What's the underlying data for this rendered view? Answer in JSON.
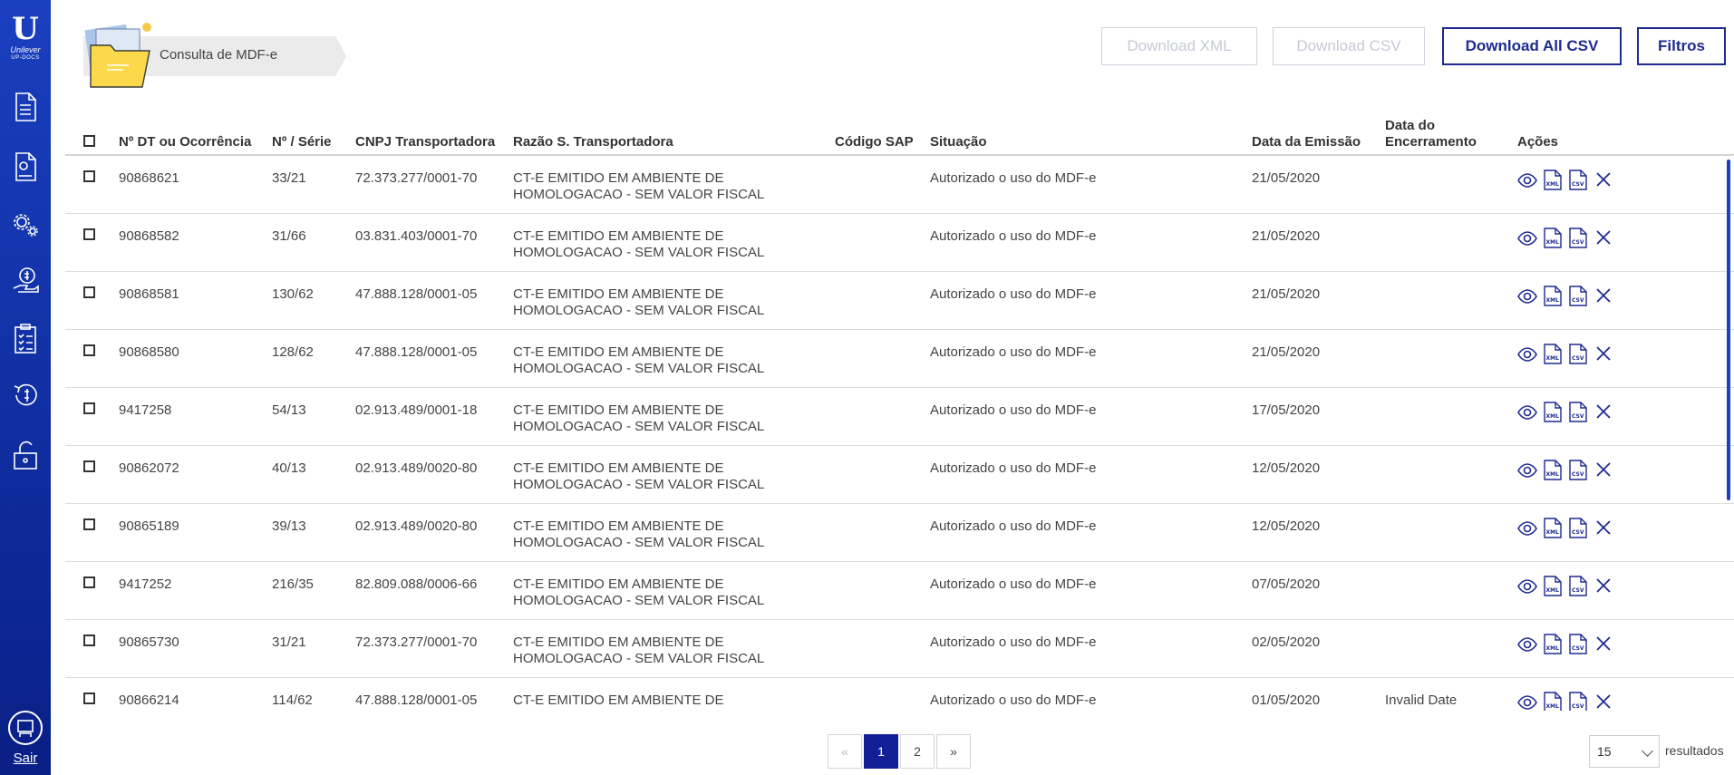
{
  "app": {
    "brand": "Unilever",
    "sub": "UP-DOCS",
    "logout_label": "Sair"
  },
  "breadcrumb": {
    "title": "Consulta de MDF-e"
  },
  "toolbar": {
    "download_xml": "Download XML",
    "download_csv": "Download CSV",
    "download_all_csv": "Download All CSV",
    "filters": "Filtros"
  },
  "table": {
    "headers": {
      "dt": "Nº DT ou Ocorrência",
      "serie": "Nº / Série",
      "cnpj": "CNPJ Transportadora",
      "razao": "Razão S. Transportadora",
      "sap": "Código SAP",
      "situacao": "Situação",
      "emissao": "Data da Emissão",
      "encerramento_1": "Data do",
      "encerramento_2": "Encerramento",
      "acoes": "Ações"
    },
    "rows": [
      {
        "dt": "90868621",
        "serie": "33/21",
        "cnpj": "72.373.277/0001-70",
        "razao1": "CT-E EMITIDO EM AMBIENTE DE",
        "razao2": "HOMOLOGACAO - SEM VALOR FISCAL",
        "sap": "",
        "situacao": "Autorizado o uso do MDF-e",
        "emissao": "21/05/2020",
        "encerramento": ""
      },
      {
        "dt": "90868582",
        "serie": "31/66",
        "cnpj": "03.831.403/0001-70",
        "razao1": "CT-E EMITIDO EM AMBIENTE DE",
        "razao2": "HOMOLOGACAO - SEM VALOR FISCAL",
        "sap": "",
        "situacao": "Autorizado o uso do MDF-e",
        "emissao": "21/05/2020",
        "encerramento": ""
      },
      {
        "dt": "90868581",
        "serie": "130/62",
        "cnpj": "47.888.128/0001-05",
        "razao1": "CT-E EMITIDO EM AMBIENTE DE",
        "razao2": "HOMOLOGACAO - SEM VALOR FISCAL",
        "sap": "",
        "situacao": "Autorizado o uso do MDF-e",
        "emissao": "21/05/2020",
        "encerramento": ""
      },
      {
        "dt": "90868580",
        "serie": "128/62",
        "cnpj": "47.888.128/0001-05",
        "razao1": "CT-E EMITIDO EM AMBIENTE DE",
        "razao2": "HOMOLOGACAO - SEM VALOR FISCAL",
        "sap": "",
        "situacao": "Autorizado o uso do MDF-e",
        "emissao": "21/05/2020",
        "encerramento": ""
      },
      {
        "dt": "9417258",
        "serie": "54/13",
        "cnpj": "02.913.489/0001-18",
        "razao1": "CT-E EMITIDO EM AMBIENTE DE",
        "razao2": "HOMOLOGACAO - SEM VALOR FISCAL",
        "sap": "",
        "situacao": "Autorizado o uso do MDF-e",
        "emissao": "17/05/2020",
        "encerramento": ""
      },
      {
        "dt": "90862072",
        "serie": "40/13",
        "cnpj": "02.913.489/0020-80",
        "razao1": "CT-E EMITIDO EM AMBIENTE DE",
        "razao2": "HOMOLOGACAO - SEM VALOR FISCAL",
        "sap": "",
        "situacao": "Autorizado o uso do MDF-e",
        "emissao": "12/05/2020",
        "encerramento": ""
      },
      {
        "dt": "90865189",
        "serie": "39/13",
        "cnpj": "02.913.489/0020-80",
        "razao1": "CT-E EMITIDO EM AMBIENTE DE",
        "razao2": "HOMOLOGACAO - SEM VALOR FISCAL",
        "sap": "",
        "situacao": "Autorizado o uso do MDF-e",
        "emissao": "12/05/2020",
        "encerramento": ""
      },
      {
        "dt": "9417252",
        "serie": "216/35",
        "cnpj": "82.809.088/0006-66",
        "razao1": "CT-E EMITIDO EM AMBIENTE DE",
        "razao2": "HOMOLOGACAO - SEM VALOR FISCAL",
        "sap": "",
        "situacao": "Autorizado o uso do MDF-e",
        "emissao": "07/05/2020",
        "encerramento": ""
      },
      {
        "dt": "90865730",
        "serie": "31/21",
        "cnpj": "72.373.277/0001-70",
        "razao1": "CT-E EMITIDO EM AMBIENTE DE",
        "razao2": "HOMOLOGACAO - SEM VALOR FISCAL",
        "sap": "",
        "situacao": "Autorizado o uso do MDF-e",
        "emissao": "02/05/2020",
        "encerramento": ""
      },
      {
        "dt": "90866214",
        "serie": "114/62",
        "cnpj": "47.888.128/0001-05",
        "razao1": "CT-E EMITIDO EM AMBIENTE DE",
        "razao2": "",
        "sap": "",
        "situacao": "Autorizado o uso do MDF-e",
        "emissao": "01/05/2020",
        "encerramento": "Invalid Date"
      }
    ],
    "action_icons": [
      "eye-icon",
      "xml-file-icon",
      "csv-file-icon",
      "close-icon"
    ]
  },
  "pagination": {
    "prev": "«",
    "pages": [
      "1",
      "2"
    ],
    "next": "»",
    "current": "1"
  },
  "page_size": {
    "value": "15",
    "suffix": "resultados"
  },
  "colors": {
    "primary": "#1e2b8f",
    "sidebar": "#1a3fbf",
    "active_page": "#121f96"
  }
}
